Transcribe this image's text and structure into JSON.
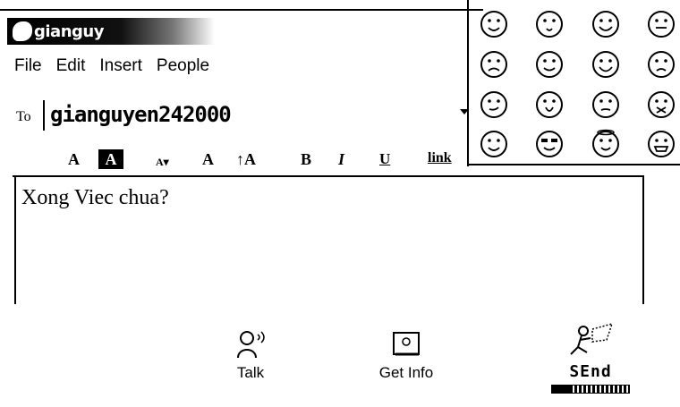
{
  "window": {
    "logo_text": "gianguy"
  },
  "menu": {
    "items": [
      "File",
      "Edit",
      "Insert",
      "People"
    ]
  },
  "to": {
    "label": "To",
    "value": "gianguyen242000"
  },
  "format_toolbar": {
    "text_color": "A",
    "highlight": "A",
    "size_down": "A▾",
    "normal": "A",
    "size_up": "↑A",
    "bold": "B",
    "italic": "I",
    "underline": "U",
    "link": "link"
  },
  "message": {
    "text": "Xong Viec chua?"
  },
  "emoticons": [
    "smile-icon",
    "surprised-icon",
    "grin-icon",
    "tongue-icon",
    "sad-icon",
    "wink-icon",
    "laugh-icon",
    "crying-icon",
    "smirk-icon",
    "shout-icon",
    "angry-icon",
    "sick-icon",
    "happy-icon",
    "cool-icon",
    "angel-icon",
    "teeth-icon"
  ],
  "actions": {
    "talk_label": "Talk",
    "get_info_label": "Get Info",
    "send_label": "SEnd"
  },
  "send_progress": 0.25
}
